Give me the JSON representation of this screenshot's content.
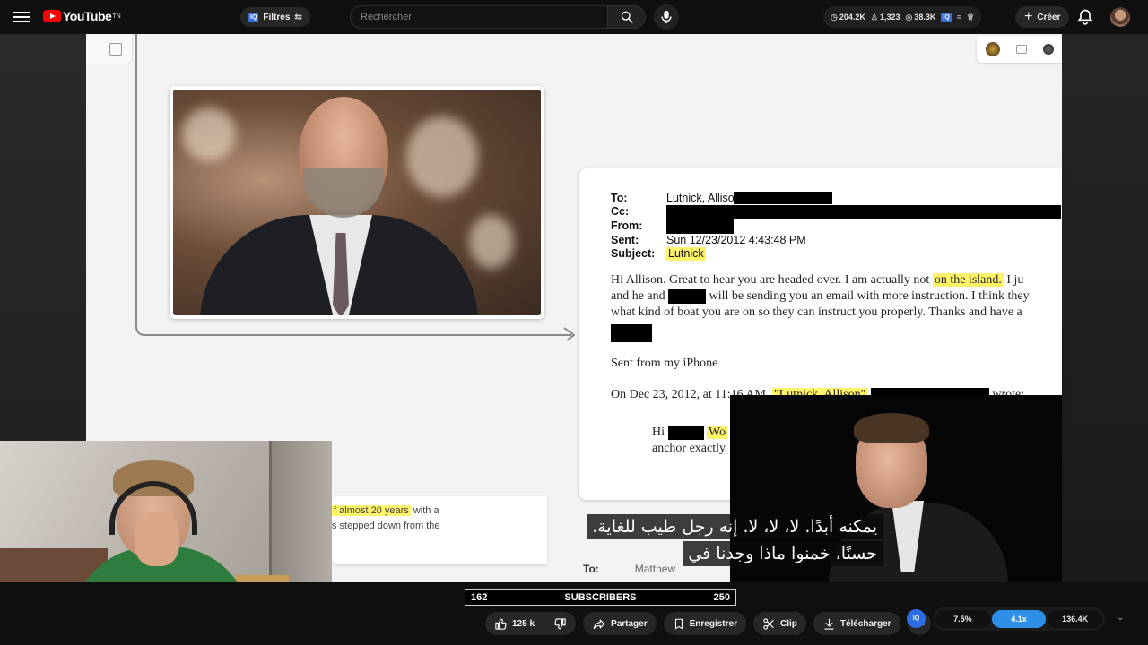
{
  "header": {
    "logo_text": "YouTube",
    "logo_sup": "TN",
    "filter_label": "Filtres",
    "filter_badge": "IQ",
    "search_placeholder": "Rechercher",
    "stats": {
      "views": "204.2K",
      "comments": "1,323",
      "likes": "38.3K",
      "badge": "IQ"
    },
    "create_label": "Créer"
  },
  "video": {
    "email": {
      "to_label": "To:",
      "to_value": "Lutnick, Allison",
      "cc_label": "Cc:",
      "from_label": "From:",
      "sent_label": "Sent:",
      "sent_value": "Sun 12/23/2012 4:43:48 PM",
      "subject_label": "Subject:",
      "subject_value": "Lutnick",
      "body_line1_a": "Hi Allison. Great to hear you are headed over. I am actually not",
      "body_line1_hl": "on the island.",
      "body_line1_b": "I ju",
      "body_line2_a": "and he and",
      "body_line2_b": "will be sending you an email with more instruction. I think they",
      "body_line3": "what kind of boat you are on so they can instruct you properly. Thanks and have a",
      "sent_from": "Sent from my iPhone",
      "reply_a": "On Dec 23, 2012, at 11:16 AM,",
      "reply_hl": "\"Lutnick, Allison\"",
      "reply_b": "wrote:",
      "quote_hi": "Hi",
      "quote_hl": "Wo",
      "quote_line2": "anchor exactly"
    },
    "snippet": {
      "line1_hl": "f almost 20 years",
      "line1_b": "with a",
      "line2": "s stepped down from the"
    },
    "to_fragment_label": "To:",
    "to_fragment_value": "Matthew",
    "subtitles": {
      "line1": "يمكنه أبدًا. لا، لا، لا. إنه رجل طيب للغاية.",
      "line2": "حسنًا، خمنوا ماذا وجدنا في"
    },
    "subscribers": {
      "start": "162",
      "label": "SUBSCRIBERS",
      "end": "250"
    }
  },
  "actions": {
    "likes": "125 k",
    "share": "Partager",
    "save": "Enregistrer",
    "clip": "Clip",
    "download": "Télécharger",
    "iq_badge": "IQ",
    "ratios": [
      "7.5%",
      "4.1x",
      "136.4K"
    ],
    "active_ratio_index": 1
  }
}
